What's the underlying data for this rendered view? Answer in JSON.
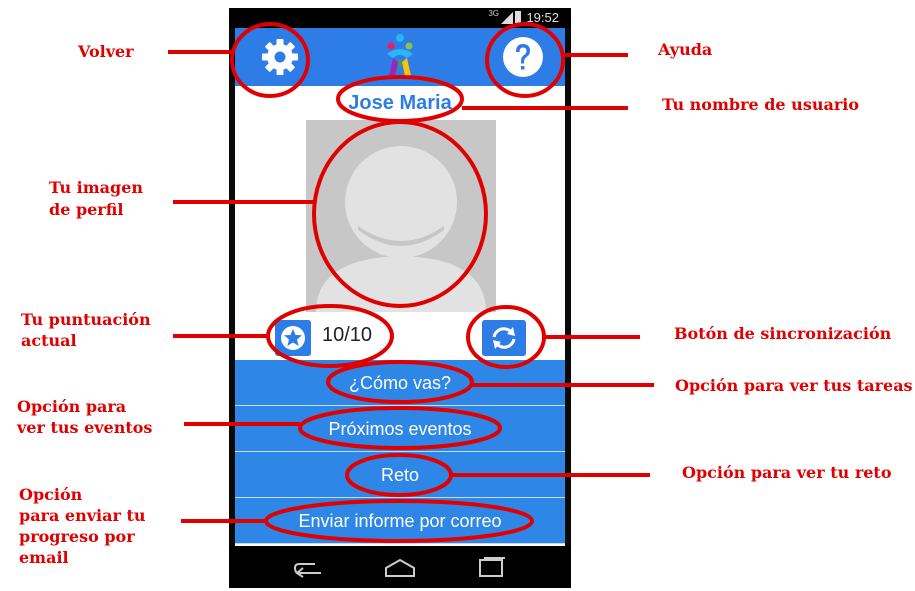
{
  "status_bar": {
    "time": "19:52",
    "network": "3G"
  },
  "app": {
    "username": "Jose Maria",
    "score": "10/10",
    "menu": [
      {
        "label": "¿Cómo vas?"
      },
      {
        "label": "Próximos eventos"
      },
      {
        "label": "Reto"
      },
      {
        "label": "Enviar informe por correo"
      }
    ]
  },
  "annotations": {
    "volver": "Volver",
    "ayuda": "Ayuda",
    "nombre": "Tu nombre de usuario",
    "imagen_1": "Tu imagen",
    "imagen_2": "de perfil",
    "puntuacion_1": "Tu puntuación",
    "puntuacion_2": "actual",
    "sincronizacion": "Botón de sincronización",
    "tareas": "Opción para ver tus tareas",
    "eventos_1": "Opción para",
    "eventos_2": "ver tus eventos",
    "reto": "Opción para ver tu reto",
    "email_1": "Opción",
    "email_2": "para enviar tu",
    "email_3": "progreso por",
    "email_4": "email"
  },
  "icons": [
    "gear-icon",
    "help-icon",
    "app-logo",
    "star-icon",
    "sync-icon",
    "back-icon",
    "home-icon",
    "recents-icon"
  ],
  "colors": {
    "primary": "#2E7CE6",
    "annotation": "#E10000"
  }
}
